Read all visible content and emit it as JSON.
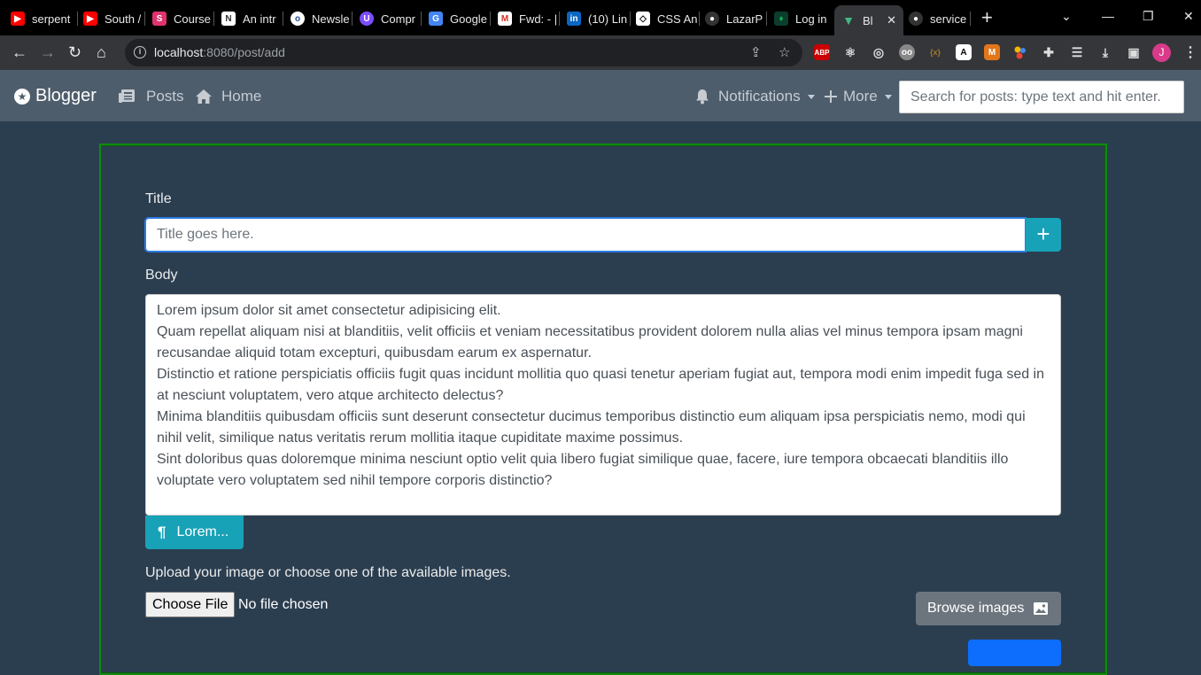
{
  "browser": {
    "tabs": [
      {
        "label": "serpent",
        "icon": "youtube-icon"
      },
      {
        "label": "South /",
        "icon": "youtube-icon"
      },
      {
        "label": "Course",
        "icon": "coursera-icon"
      },
      {
        "label": "An intr",
        "icon": "site-icon"
      },
      {
        "label": "Newsle",
        "icon": "site-icon"
      },
      {
        "label": "Compr",
        "icon": "site-icon"
      },
      {
        "label": "Google",
        "icon": "google-translate-icon"
      },
      {
        "label": "Fwd: - |",
        "icon": "gmail-icon"
      },
      {
        "label": "(10) Lin",
        "icon": "linkedin-icon"
      },
      {
        "label": "CSS An",
        "icon": "codepen-icon"
      },
      {
        "label": "LazarP",
        "icon": "github-icon"
      },
      {
        "label": "Log in",
        "icon": "mongodb-icon"
      },
      {
        "label": "Bl",
        "icon": "vue-icon"
      },
      {
        "label": "service",
        "icon": "github-icon"
      }
    ],
    "url_host": "localhost",
    "url_rest": ":8080/post/add",
    "profile_initial": "J",
    "colors": {
      "tab_bar": "#000000",
      "toolbar": "#35363a",
      "omnibox": "#202124"
    }
  },
  "navbar": {
    "brand": "Blogger",
    "posts": "Posts",
    "home": "Home",
    "notifications": "Notifications",
    "more": "More",
    "search_placeholder": "Search for posts: type text and hit enter."
  },
  "form": {
    "title_label": "Title",
    "title_placeholder": "Title goes here.",
    "add_symbol": "+",
    "body_label": "Body",
    "body_text": "Lorem ipsum dolor sit amet consectetur adipisicing elit.\nQuam repellat aliquam nisi at blanditiis, velit officiis et veniam necessitatibus provident dolorem nulla alias vel minus tempora ipsam magni recusandae aliquid totam excepturi, quibusdam earum ex aspernatur.\nDistinctio et ratione perspiciatis officiis fugit quas incidunt mollitia quo quasi tenetur aperiam fugiat aut, tempora modi enim impedit fuga sed in at nesciunt voluptatem, vero atque architecto delectus?\nMinima blanditiis quibusdam officiis sunt deserunt consectetur ducimus temporibus distinctio eum aliquam ipsa perspiciatis nemo, modi qui nihil velit, similique natus veritatis rerum mollitia itaque cupiditate maxime possimus.\nSint doloribus quas doloremque minima nesciunt optio velit quia libero fugiat similique quae, facere, iure tempora obcaecati blanditiis illo voluptate vero voluptatem sed nihil tempore corporis distinctio?",
    "lorem_button": "Lorem...",
    "lorem_symbol": "¶",
    "upload_text": "Upload your image or choose one of the available images.",
    "choose_file": "Choose File",
    "file_status": "No file chosen",
    "browse_button": "Browse images"
  },
  "colors": {
    "page_bg": "#2b3e50",
    "navbar_bg": "#4e5d6c",
    "card_border": "#0f8a0f",
    "info": "#17a2b8",
    "secondary": "#6c757d",
    "primary": "#0d6efd"
  }
}
